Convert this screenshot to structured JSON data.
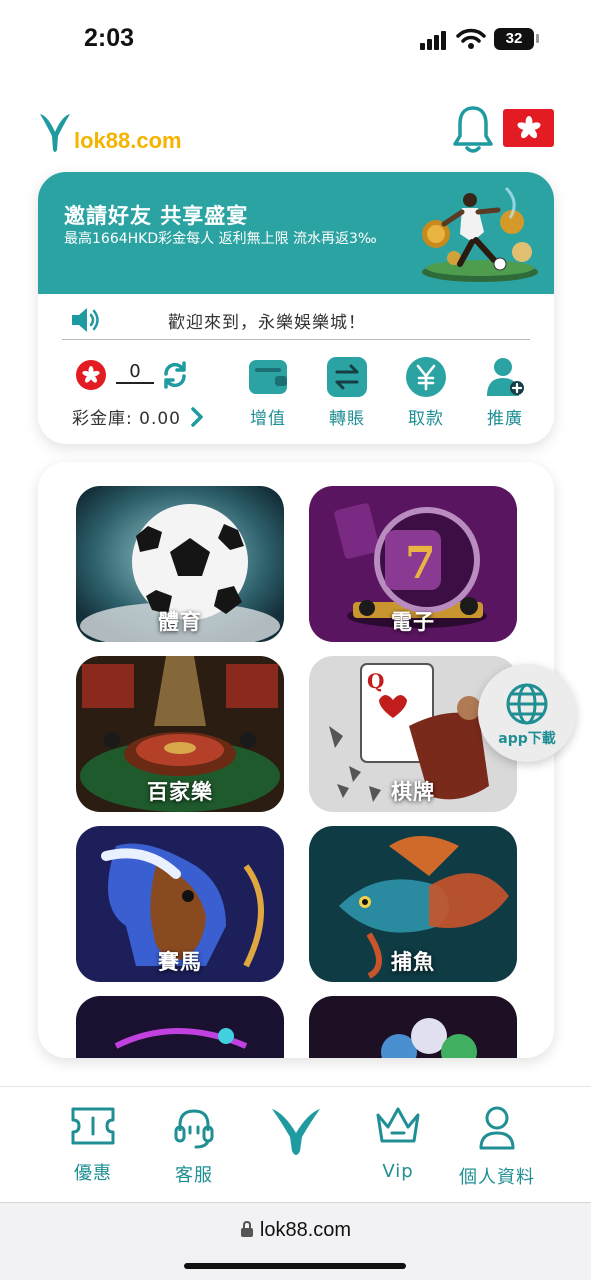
{
  "status_bar": {
    "time": "2:03",
    "battery": "32"
  },
  "header": {
    "logo_text": "lok88.com",
    "colors": {
      "accent": "#1f8f94",
      "logo_gold": "#f5b400",
      "flag_red": "#e31b23"
    }
  },
  "promo": {
    "title": "邀請好友 共享盛宴",
    "subtitle": "最高1664HKD彩金每人 返利無上限 流水再返3‰"
  },
  "marquee": {
    "text": "歡迎來到，永樂娛樂城！"
  },
  "wallet": {
    "balance": "0",
    "bonus_label": "彩金庫: 0.00"
  },
  "actions": [
    {
      "label": "增值",
      "icon": "wallet-icon"
    },
    {
      "label": "轉賬",
      "icon": "transfer-icon"
    },
    {
      "label": "取款",
      "icon": "yen-icon"
    },
    {
      "label": "推廣",
      "icon": "add-user-icon"
    }
  ],
  "games": [
    {
      "label": "體育"
    },
    {
      "label": "電子"
    },
    {
      "label": "百家樂"
    },
    {
      "label": "棋牌"
    },
    {
      "label": "賽馬"
    },
    {
      "label": "捕魚"
    }
  ],
  "app_download": {
    "label": "app下載"
  },
  "bottom_nav": [
    {
      "label": "優惠",
      "icon": "ticket-icon"
    },
    {
      "label": "客服",
      "icon": "headset-icon"
    },
    {
      "label": "",
      "icon": "home-logo-icon"
    },
    {
      "label": "Vip",
      "icon": "crown-icon"
    },
    {
      "label": "個人資料",
      "icon": "person-icon"
    }
  ],
  "browser": {
    "url": "lok88.com"
  }
}
